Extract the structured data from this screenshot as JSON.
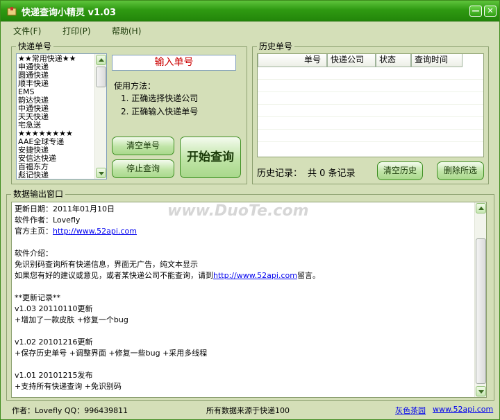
{
  "window": {
    "title": "快递查询小精灵 v1.03",
    "minimize_glyph": "—",
    "close_glyph": "✕",
    "app_icon": "package-icon",
    "accent": "#2f9a12"
  },
  "menu": {
    "items": [
      {
        "label": "文件(F)"
      },
      {
        "label": "打印(P)"
      },
      {
        "label": "帮助(H)"
      }
    ]
  },
  "express_panel": {
    "title": "快递单号",
    "companies": [
      "★★常用快递★★",
      "申通快递",
      "圆通快递",
      "顺丰快递",
      "EMS",
      "韵达快递",
      "中通快递",
      "天天快递",
      "宅急送",
      "★★★★★★★★",
      "AAE全球专递",
      "安捷快递",
      "安信达快递",
      "百福东方",
      "彪记快递"
    ],
    "order_input_value": "输入单号",
    "usage_title": "使用方法：",
    "usage_steps": [
      "1. 正确选择快递公司",
      "2. 正确输入快递单号"
    ],
    "clear_order_label": "清空单号",
    "stop_query_label": "停止查询",
    "start_query_label": "开始查询"
  },
  "history_panel": {
    "title": "历史单号",
    "columns": [
      "单号",
      "快递公司",
      "状态",
      "查询时间"
    ],
    "summary_label": "历史记录：",
    "summary_count": "共 0 条记录",
    "clear_history_label": "清空历史",
    "delete_selected_label": "删除所选"
  },
  "output_panel": {
    "title": "数据输出窗口",
    "lines": [
      {
        "text": "更新日期：2011年01月10日",
        "link": ""
      },
      {
        "text": "软件作者：Lovefly",
        "link": ""
      },
      {
        "text": "官方主页：",
        "link": "http://www.52api.com"
      },
      {
        "text": "",
        "link": ""
      },
      {
        "text": "软件介绍：",
        "link": ""
      },
      {
        "text": "免识别码查询所有快递信息，界面无广告，纯文本显示",
        "link": ""
      },
      {
        "text": "如果您有好的建议或意见，或者某快递公司不能查询，请到",
        "link": "http://www.52api.com",
        "after": "留言。"
      },
      {
        "text": "",
        "link": ""
      },
      {
        "text": "**更新记录**",
        "link": ""
      },
      {
        "text": "v1.03  20110110更新",
        "link": ""
      },
      {
        "text": "+增加了一款皮肤  +修复一个bug",
        "link": ""
      },
      {
        "text": "",
        "link": ""
      },
      {
        "text": "v1.02  20101216更新",
        "link": ""
      },
      {
        "text": "+保存历史单号   +调整界面   +修复一些bug   +采用多线程",
        "link": ""
      },
      {
        "text": "",
        "link": ""
      },
      {
        "text": "v1.01 20101215发布",
        "link": ""
      },
      {
        "text": "+支持所有快递查询   +免识别码",
        "link": ""
      }
    ]
  },
  "status_bar": {
    "author": "作者：Lovefly  QQ：996439811",
    "source": "所有数据来源于快递100",
    "skin_label": "灰色茶园",
    "skin_link": "www.52api.com"
  },
  "watermark": "www.DuoTe.com"
}
